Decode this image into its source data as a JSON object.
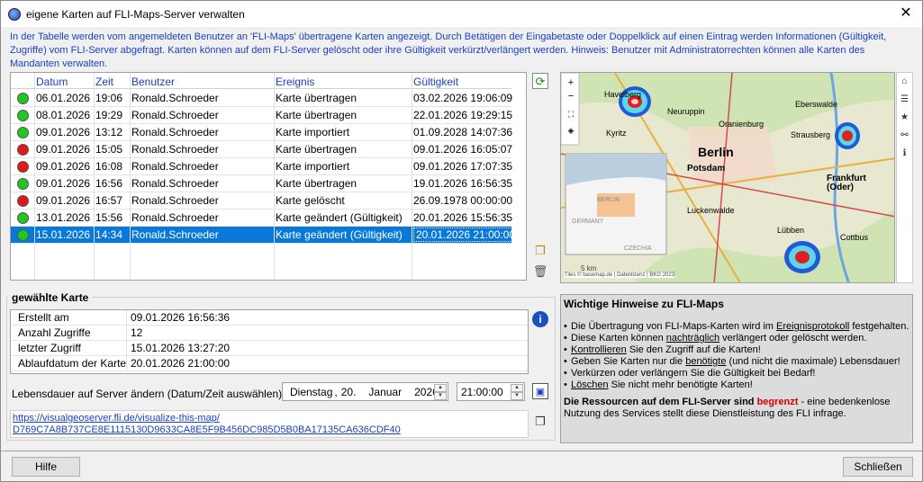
{
  "window": {
    "title": "eigene Karten auf FLI-Maps-Server verwalten",
    "app_icon_text": "FLI"
  },
  "hint": "In der Tabelle werden vom angemeldeten Benutzer an 'FLI-Maps' übertragene Karten angezeigt. Durch Betätigen der Eingabetaste oder Doppelklick auf einen Eintrag werden Informationen (Gültigkeit, Zugriffe) vom FLI-Server abgefragt. Karten können auf dem FLI-Server gelöscht oder ihre Gültigkeit verkürzt/verlängert werden. Hinweis: Benutzer mit Administratorrechten können alle Karten des Mandanten verwalten.",
  "table": {
    "columns": [
      "Datum",
      "Zeit",
      "Benutzer",
      "Ereignis",
      "Gültigkeit"
    ],
    "rows": [
      {
        "status": "green",
        "datum": "06.01.2026",
        "zeit": "19:06",
        "benutzer": "Ronald.Schroeder",
        "ereignis": "Karte übertragen",
        "gueltigkeit": "03.02.2026 19:06:09"
      },
      {
        "status": "green",
        "datum": "08.01.2026",
        "zeit": "19:29",
        "benutzer": "Ronald.Schroeder",
        "ereignis": "Karte übertragen",
        "gueltigkeit": "22.01.2026 19:29:15"
      },
      {
        "status": "green",
        "datum": "09.01.2026",
        "zeit": "13:12",
        "benutzer": "Ronald.Schroeder",
        "ereignis": "Karte importiert",
        "gueltigkeit": "01.09.2028 14:07:36"
      },
      {
        "status": "red",
        "datum": "09.01.2026",
        "zeit": "15:05",
        "benutzer": "Ronald.Schroeder",
        "ereignis": "Karte übertragen",
        "gueltigkeit": "09.01.2026 16:05:07"
      },
      {
        "status": "red",
        "datum": "09.01.2026",
        "zeit": "16:08",
        "benutzer": "Ronald.Schroeder",
        "ereignis": "Karte importiert",
        "gueltigkeit": "09.01.2026 17:07:35"
      },
      {
        "status": "green",
        "datum": "09.01.2026",
        "zeit": "16:56",
        "benutzer": "Ronald.Schroeder",
        "ereignis": "Karte übertragen",
        "gueltigkeit": "19.01.2026 16:56:35"
      },
      {
        "status": "red",
        "datum": "09.01.2026",
        "zeit": "16:57",
        "benutzer": "Ronald.Schroeder",
        "ereignis": "Karte gelöscht",
        "gueltigkeit": "26.09.1978 00:00:00"
      },
      {
        "status": "green",
        "datum": "13.01.2026",
        "zeit": "15:56",
        "benutzer": "Ronald.Schroeder",
        "ereignis": "Karte geändert (Gültigkeit)",
        "gueltigkeit": "20.01.2026 15:56:35"
      },
      {
        "status": "green",
        "datum": "15.01.2026",
        "zeit": "14:34",
        "benutzer": "Ronald.Schroeder",
        "ereignis": "Karte geändert (Gültigkeit)",
        "gueltigkeit": "20.01.2026 21:00:00",
        "selected": true
      }
    ]
  },
  "colors": {
    "green": "#1ec81e",
    "red": "#e01818",
    "selection": "#0a78d7",
    "link": "#1a3fc0",
    "warn": "#d00000"
  },
  "map": {
    "labels": {
      "havelberg": "Havelberg",
      "berlin": "Berlin",
      "potsdam": "Potsdam",
      "frankfurt": "Frankfurt (Oder)",
      "kyritz": "Kyritz",
      "neuruppin": "Neuruppin",
      "oranienburg": "Oranienburg",
      "strausberg": "Strausberg",
      "luckenwalde": "Luckenwalde",
      "eberswalde": "Eberswalde",
      "lubben": "Lübben",
      "cottbus": "Cottbus",
      "germany": "GERMANY",
      "czechia": "CZECHIA",
      "berlin_inset": "BERLIN"
    },
    "attribution": "Tiles © basemap.de | Datenlizenz | BKG 2023",
    "scale": "5 km",
    "controls": [
      "zoom-in",
      "zoom-out",
      "fullscreen",
      "layers",
      "home",
      "fit"
    ],
    "side_icons": [
      "home-icon",
      "list-icon",
      "star-icon",
      "share-icon",
      "info-icon"
    ]
  },
  "selected": {
    "heading": "gewählte Karte",
    "props": [
      {
        "key": "Erstellt am",
        "value": "09.01.2026 16:56:36"
      },
      {
        "key": "Anzahl Zugriffe",
        "value": "12"
      },
      {
        "key": "letzter Zugriff",
        "value": "15.01.2026 13:27:20"
      },
      {
        "key": "Ablaufdatum der Karte",
        "value": "20.01.2026 21:00:00"
      }
    ],
    "lifetime_label": "Lebensdauer auf Server ändern (Datum/Zeit auswählen) :",
    "date": {
      "weekday": "Dienstag",
      "sep": ",",
      "day": "20.",
      "month": "Januar",
      "year": "2026"
    },
    "time": "21:00:00",
    "url_line1": "https://visualgeoserver.fli.de/visualize-this-map/",
    "url_line2": "D769C7A8B737CE8E1115130D9633CA8E5F9B456DC985D5B0BA17135CA636CDF40"
  },
  "notes": {
    "title": "Wichtige Hinweise zu FLI-Maps",
    "items": [
      [
        "Die Übertragung von FLI-Maps-Karten wird im ",
        "Ereignisprotokoll",
        " festgehalten."
      ],
      [
        "Diese Karten können ",
        "nachträglich",
        " verlängert oder gelöscht werden."
      ],
      [
        "",
        "Kontrollieren",
        " Sie den Zugriff auf die Karten!"
      ],
      [
        "Geben Sie Karten nur die ",
        "benötigte",
        " (und nicht die maximale) Lebensdauer!"
      ],
      [
        "Verkürzen oder verlängern Sie die Gültigkeit bei Bedarf!",
        "",
        ""
      ],
      [
        "",
        "Löschen",
        " Sie nicht mehr benötigte Karten!"
      ]
    ],
    "footer_bold": "Die Ressourcen auf dem FLI-Server sind ",
    "footer_red": "begrenzt",
    "footer_rest": " - eine bedenkenlose Nutzung des Services stellt diese Dienstleistung des FLI infrage."
  },
  "buttons": {
    "help": "Hilfe",
    "close": "Schließen"
  }
}
